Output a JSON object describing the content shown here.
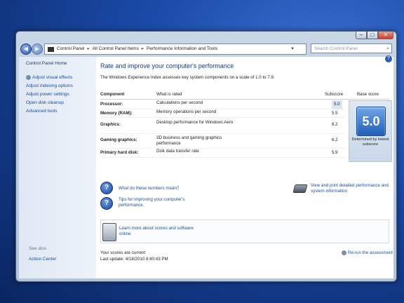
{
  "address_bar": {
    "crumbs": [
      "Control Panel",
      "All Control Panel Items",
      "Performance Information and Tools"
    ],
    "search_placeholder": "Search Control Panel"
  },
  "left_pane": {
    "home": "Control Panel Home",
    "items": [
      "Adjust visual effects",
      "Adjust indexing options",
      "Adjust power settings",
      "Open disk cleanup",
      "Advanced tools"
    ],
    "see_also": "See also",
    "action_center": "Action Center"
  },
  "main": {
    "heading": "Rate and improve your computer's performance",
    "subtitle": "The Windows Experience Index assesses key system components on a scale of 1.0 to 7.9.",
    "table": {
      "headers": [
        "Component",
        "What is rated",
        "Subscore",
        "Base score"
      ],
      "rows": [
        {
          "component": "Processor:",
          "what": "Calculations per second",
          "subscore": "5.0"
        },
        {
          "component": "Memory (RAM):",
          "what": "Memory operations per second",
          "subscore": "5.5"
        },
        {
          "component": "Graphics:",
          "what": "Desktop performance for Windows Aero",
          "subscore": "6.2"
        },
        {
          "component": "Gaming graphics:",
          "what": "3D business and gaming graphics performance",
          "subscore": "6.2"
        },
        {
          "component": "Primary hard disk:",
          "what": "Disk data transfer rate",
          "subscore": "5.9"
        }
      ],
      "base_score": "5.0",
      "base_note": "Determined by lowest subscore"
    },
    "links": {
      "what_mean": "What do these numbers mean?",
      "tips": "Tips for improving your computer's performance.",
      "view_print": "View and print detailed performance and system information",
      "learn_more": "Learn more about scores and software online"
    },
    "status_current": "Your scores are current",
    "last_update": "Last update: 4/18/2010 8:40:43 PM",
    "rerun": "Re-run the assessment"
  }
}
